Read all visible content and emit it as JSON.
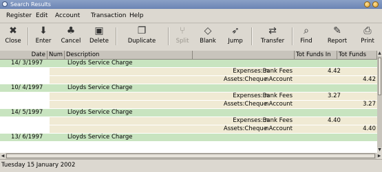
{
  "window": {
    "title": "Search Results"
  },
  "menu": [
    "Register",
    "Edit",
    "Account",
    "Transaction",
    "Help"
  ],
  "toolbar": {
    "close": "Close",
    "enter": "Enter",
    "cancel": "Cancel",
    "delete": "Delete",
    "duplicate": "Duplicate",
    "split": "Split",
    "blank": "Blank",
    "jump": "Jump",
    "transfer": "Transfer",
    "find": "Find",
    "report": "Report",
    "print": "Print"
  },
  "columns": {
    "date": "Date",
    "num": "Num",
    "description": "Description",
    "funds_in": "Tot Funds In",
    "funds_out": "Tot Funds Out"
  },
  "rows": [
    {
      "type": "txn",
      "date": "14/ 3/1997",
      "description": "Lloyds Service Charge"
    },
    {
      "type": "split",
      "account": "Expenses:Bank Fees",
      "flag": "n",
      "in": "4.42",
      "out": ""
    },
    {
      "type": "split",
      "account": "Assets:Cheque Account",
      "flag": "n",
      "in": "",
      "out": "4.42"
    },
    {
      "type": "txn",
      "date": "10/ 4/1997",
      "description": "Lloyds Service Charge"
    },
    {
      "type": "split",
      "account": "Expenses:Bank Fees",
      "flag": "n",
      "in": "3.27",
      "out": ""
    },
    {
      "type": "split",
      "account": "Assets:Cheque Account",
      "flag": "n",
      "in": "",
      "out": "3.27"
    },
    {
      "type": "txn",
      "date": "14/ 5/1997",
      "description": "Lloyds Service Charge"
    },
    {
      "type": "split",
      "account": "Expenses:Bank Fees",
      "flag": "n",
      "in": "4.40",
      "out": ""
    },
    {
      "type": "split",
      "account": "Assets:Cheque Account",
      "flag": "n",
      "in": "",
      "out": "4.40"
    },
    {
      "type": "txn",
      "date": "13/ 6/1997",
      "description": "Lloyds Service Charge"
    }
  ],
  "status": "Tuesday 15 January 2002"
}
